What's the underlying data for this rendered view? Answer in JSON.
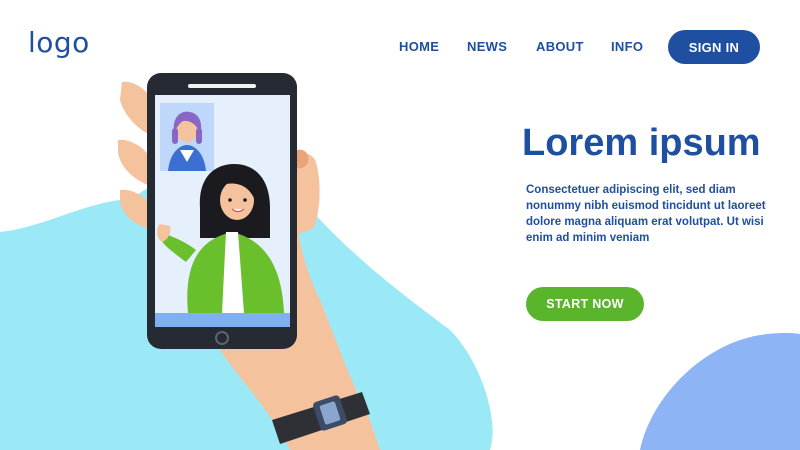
{
  "header": {
    "logo": "logo",
    "nav": [
      "HOME",
      "NEWS",
      "ABOUT",
      "INFO"
    ],
    "signin_label": "SIGN IN"
  },
  "hero": {
    "title": "Lorem ipsum",
    "body": "Consectetuer adipiscing elit, sed diam nonummy nibh euismod tincidunt ut laoreet dolore magna aliquam erat volutpat. Ut wisi enim ad minim veniam",
    "cta_label": "START NOW"
  },
  "colors": {
    "brand_blue": "#1f4fa0",
    "cta_green": "#5ab52c",
    "blob_cyan": "#9be9f7",
    "blob_blue": "#8db4f5"
  },
  "illustration": {
    "icons": [
      "hand-holding-phone-icon",
      "video-call-icon",
      "avatar-icon",
      "watch-icon"
    ]
  }
}
